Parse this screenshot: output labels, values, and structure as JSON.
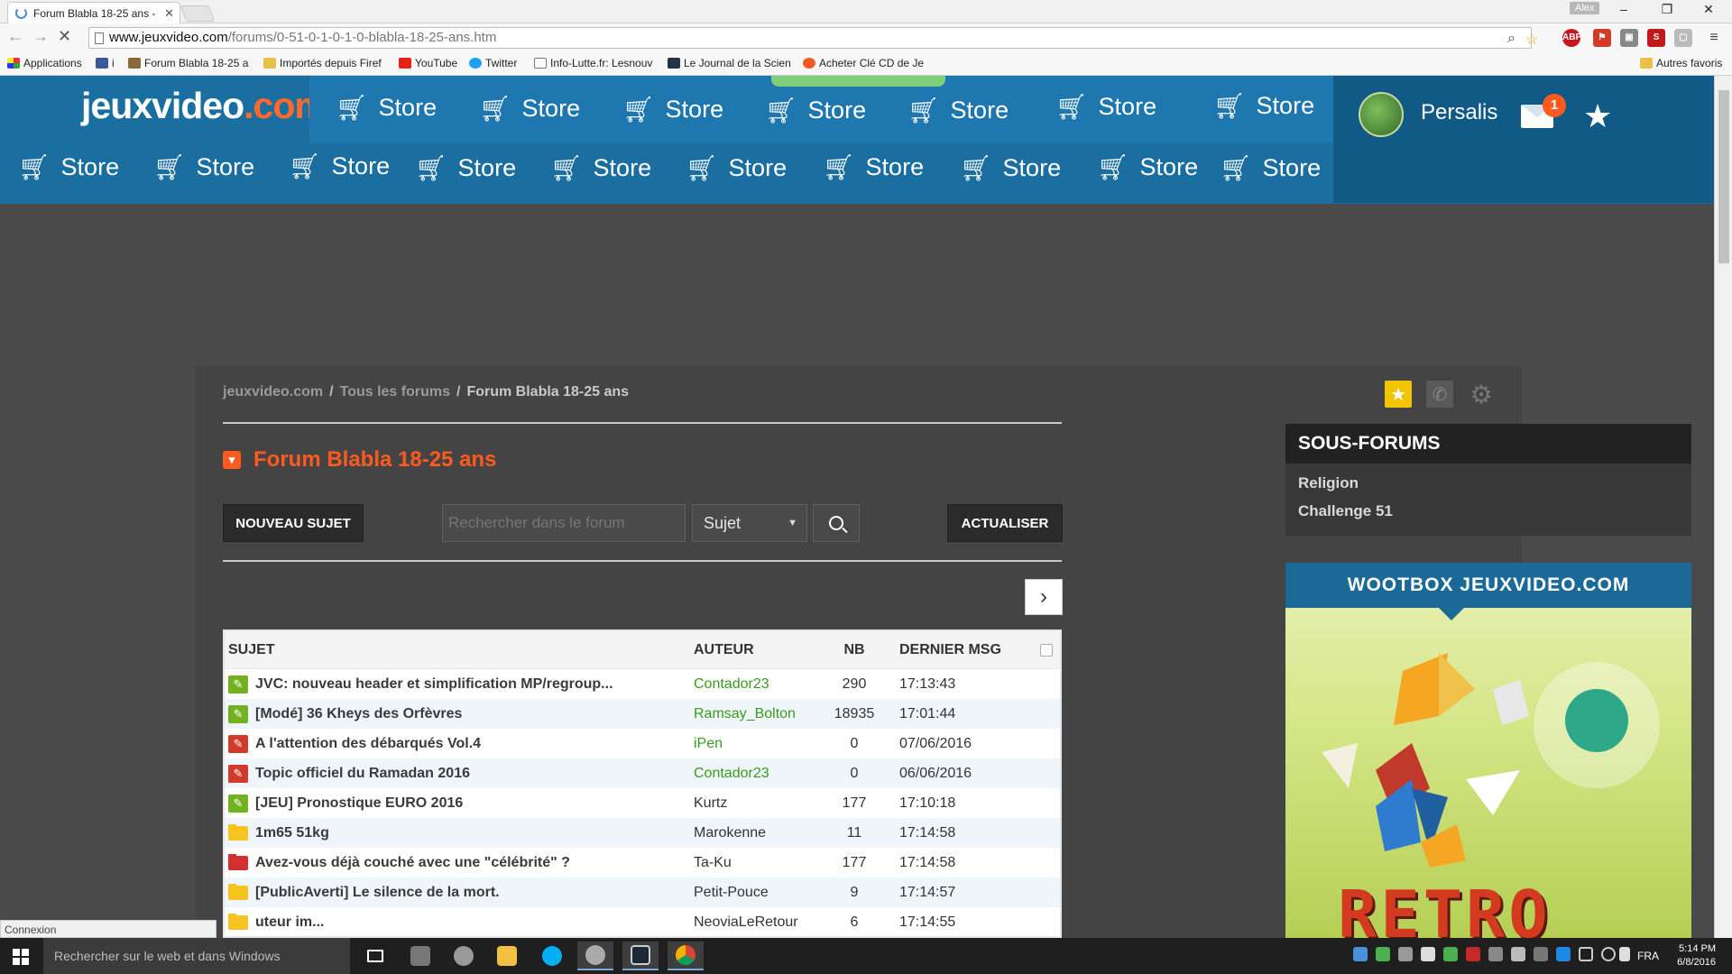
{
  "browser": {
    "tab_title": "Forum Blabla 18-25 ans -",
    "user_label": "Alex",
    "url_host": "www.jeuxvideo.com",
    "url_path": "/forums/0-51-0-1-0-1-0-blabla-18-25-ans.htm",
    "bookmarks": [
      "Applications",
      "i",
      "Forum Blabla 18-25 a",
      "Importés depuis Firef",
      "YouTube",
      "Twitter",
      "Info-Lutte.fr: Lesnouv",
      "Le Journal de la Scien",
      "Acheter Clé CD de Je"
    ],
    "other_bookmarks": "Autres favoris",
    "status_text": "Connexion"
  },
  "site": {
    "logo_main": "jeuxvideo",
    "logo_dot": ".com",
    "nav_label": "Store",
    "username": "Persalis",
    "mail_count": "1"
  },
  "page": {
    "breadcrumb": [
      "jeuxvideo.com",
      "Tous les forums",
      "Forum Blabla 18-25 ans"
    ],
    "forum_title": "Forum Blabla 18-25 ans",
    "new_topic_label": "NOUVEAU SUJET",
    "search_placeholder": "Rechercher dans le forum",
    "search_scope": "Sujet",
    "refresh_label": "ACTUALISER"
  },
  "table": {
    "headers": {
      "subject": "SUJET",
      "author": "AUTEUR",
      "count": "NB",
      "last": "DERNIER MSG"
    },
    "rows": [
      {
        "icon": "pin-green",
        "subject": "JVC: nouveau header et simplification MP/regroup...",
        "author": "Contador23",
        "author_green": true,
        "nb": "290",
        "last": "17:13:43"
      },
      {
        "icon": "pin-green",
        "subject": "[Modé] 36 Kheys des Orfèvres",
        "author": "Ramsay_Bolton",
        "author_green": true,
        "nb": "18935",
        "last": "17:01:44"
      },
      {
        "icon": "pin-red",
        "subject": "A l'attention des débarqués Vol.4",
        "author": "iPen",
        "author_green": true,
        "nb": "0",
        "last": "07/06/2016"
      },
      {
        "icon": "pin-red",
        "subject": "Topic officiel du Ramadan 2016",
        "author": "Contador23",
        "author_green": true,
        "nb": "0",
        "last": "06/06/2016"
      },
      {
        "icon": "pin-green",
        "subject": "[JEU] Pronostique EURO 2016",
        "author": "Kurtz",
        "author_green": false,
        "nb": "177",
        "last": "17:10:18"
      },
      {
        "icon": "folder-yellow",
        "subject": "1m65 51kg",
        "author": "Marokenne",
        "author_green": false,
        "nb": "11",
        "last": "17:14:58"
      },
      {
        "icon": "folder-red",
        "subject": "Avez-vous déjà couché avec une \"célébrité\" ?",
        "author": "Ta-Ku",
        "author_green": false,
        "nb": "177",
        "last": "17:14:58"
      },
      {
        "icon": "folder-yellow",
        "subject": "[PublicAverti] Le silence de la mort.",
        "author": "Petit-Pouce",
        "author_green": false,
        "nb": "9",
        "last": "17:14:57"
      },
      {
        "icon": "folder-yellow",
        "subject": "uteur im...",
        "author": "NeoviaLeRetour",
        "author_green": false,
        "nb": "6",
        "last": "17:14:55"
      }
    ]
  },
  "sidebar": {
    "subforums_title": "SOUS-FORUMS",
    "subforums": [
      "Religion",
      "Challenge 51"
    ],
    "promo_title": "WOOTBOX JEUXVIDEO.COM",
    "promo_word": "RETRO"
  },
  "taskbar": {
    "search_placeholder": "Rechercher sur le web et dans Windows",
    "lang": "FRA",
    "time": "5:14 PM",
    "date": "6/8/2016"
  },
  "colors": {
    "header_blue": "#1a6ea0",
    "accent_orange": "#ff5a1f",
    "author_green": "#3a9a1f"
  }
}
